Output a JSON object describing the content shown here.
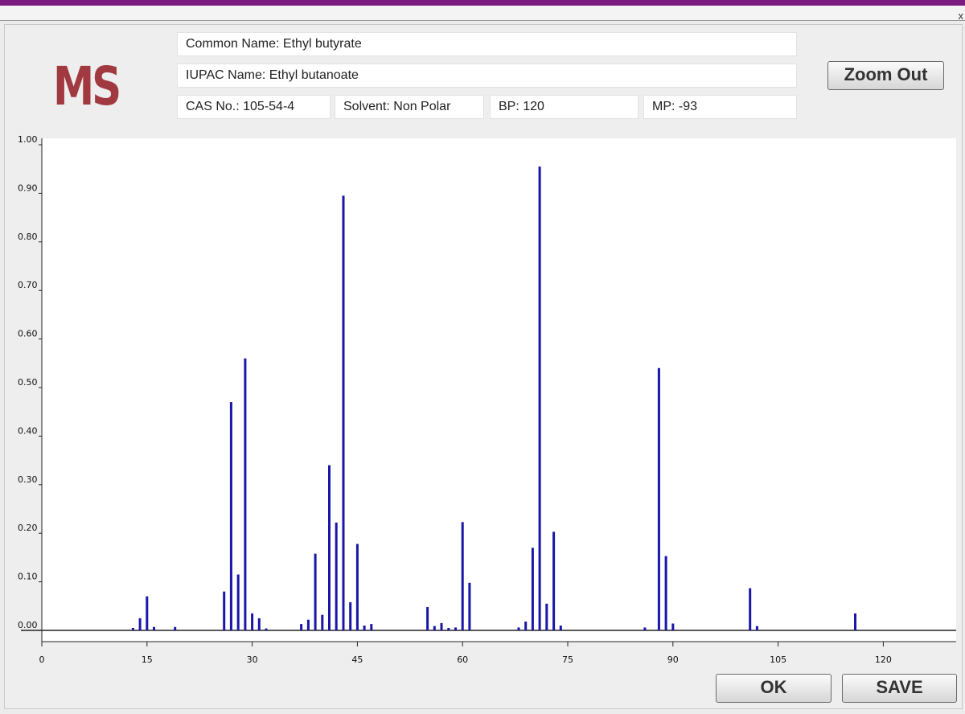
{
  "window": {
    "close_glyph": "x"
  },
  "logo": {
    "text": "MS"
  },
  "info": {
    "common_name": "Common Name:  Ethyl butyrate",
    "iupac_name": "IUPAC Name:  Ethyl butanoate",
    "cas_no": "CAS No.: 105-54-4",
    "solvent": "Solvent: Non Polar",
    "bp": "BP: 120",
    "mp": "MP: -93"
  },
  "buttons": {
    "zoom_out": "Zoom Out",
    "ok": "OK",
    "save": "SAVE"
  },
  "colors": {
    "bar": "#1a16a8",
    "title_bar": "#7b1c83",
    "logo": "#a03a40"
  },
  "chart_data": {
    "type": "bar",
    "xlim": [
      0,
      128
    ],
    "ylim": [
      0,
      1.0
    ],
    "xticks": [
      "0",
      "15",
      "30",
      "45",
      "60",
      "75",
      "90",
      "105",
      "120"
    ],
    "yticks": [
      "0.00",
      "0.10",
      "0.20",
      "0.30",
      "0.40",
      "0.50",
      "0.60",
      "0.70",
      "0.80",
      "0.90",
      "1.00"
    ],
    "grid": false,
    "legend": "none",
    "x": [
      13,
      14,
      15,
      16,
      19,
      26,
      27,
      28,
      29,
      30,
      31,
      32,
      37,
      38,
      39,
      40,
      41,
      42,
      43,
      44,
      45,
      46,
      47,
      55,
      56,
      57,
      58,
      59,
      60,
      61,
      68,
      69,
      70,
      71,
      72,
      73,
      74,
      86,
      88,
      89,
      90,
      101,
      102,
      116
    ],
    "values": [
      0.005,
      0.025,
      0.07,
      0.007,
      0.007,
      0.08,
      0.47,
      0.115,
      0.56,
      0.035,
      0.025,
      0.004,
      0.013,
      0.022,
      0.158,
      0.032,
      0.34,
      0.222,
      0.895,
      0.058,
      0.178,
      0.01,
      0.013,
      0.048,
      0.009,
      0.015,
      0.005,
      0.006,
      0.223,
      0.098,
      0.006,
      0.018,
      0.17,
      0.955,
      0.055,
      0.203,
      0.01,
      0.006,
      0.54,
      0.153,
      0.014,
      0.087,
      0.009,
      0.035
    ]
  }
}
